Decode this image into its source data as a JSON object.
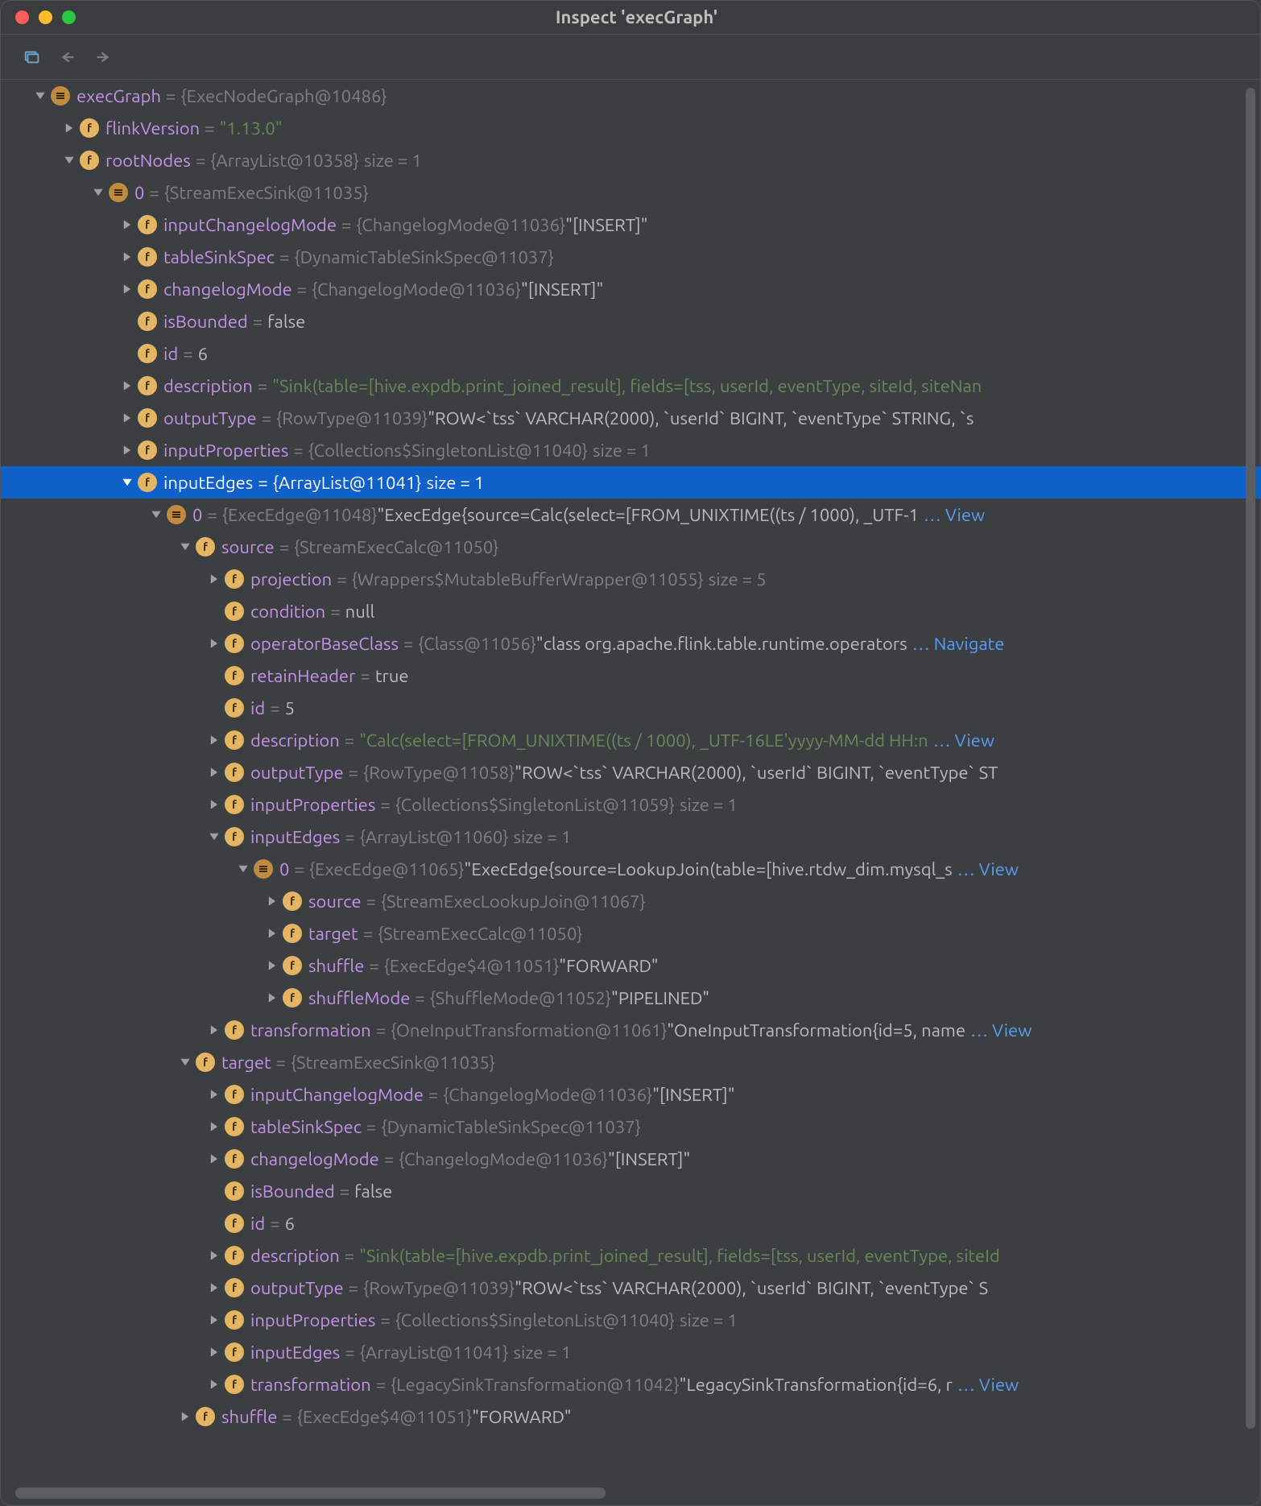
{
  "window_title": "Inspect 'execGraph'",
  "rows": [
    {
      "indent": 0,
      "chev": "down",
      "icon": "ar",
      "key": "execGraph",
      "eq": "=",
      "obj": "{ExecNodeGraph@10486}",
      "val": "",
      "link": ""
    },
    {
      "indent": 1,
      "chev": "right",
      "icon": "f",
      "key": "flinkVersion",
      "eq": "=",
      "obj": "",
      "val": "\"1.13.0\"",
      "valCls": "vstr",
      "link": ""
    },
    {
      "indent": 1,
      "chev": "down",
      "icon": "f",
      "key": "rootNodes",
      "eq": "=",
      "obj": "{ArrayList@10358}",
      "extra": "  size = 1",
      "link": ""
    },
    {
      "indent": 2,
      "chev": "down",
      "icon": "ar",
      "key": "0",
      "eq": "=",
      "obj": "{StreamExecSink@11035}",
      "link": ""
    },
    {
      "indent": 3,
      "chev": "right",
      "icon": "f",
      "key": "inputChangelogMode",
      "eq": "=",
      "obj": "{ChangelogMode@11036}",
      "val": " \"[INSERT]\"",
      "link": ""
    },
    {
      "indent": 3,
      "chev": "right",
      "icon": "f",
      "key": "tableSinkSpec",
      "eq": "=",
      "obj": "{DynamicTableSinkSpec@11037}",
      "link": ""
    },
    {
      "indent": 3,
      "chev": "right",
      "icon": "f",
      "key": "changelogMode",
      "eq": "=",
      "obj": "{ChangelogMode@11036}",
      "val": " \"[INSERT]\"",
      "link": ""
    },
    {
      "indent": 3,
      "chev": "none",
      "icon": "f",
      "key": "isBounded",
      "eq": "=",
      "obj": "",
      "val": "false",
      "link": ""
    },
    {
      "indent": 3,
      "chev": "none",
      "icon": "f",
      "key": "id",
      "eq": "=",
      "obj": "",
      "val": "6",
      "link": ""
    },
    {
      "indent": 3,
      "chev": "right",
      "icon": "f",
      "key": "description",
      "eq": "=",
      "obj": "",
      "val": "\"Sink(table=[hive.expdb.print_joined_result], fields=[tss, userId, eventType, siteId, siteNan",
      "valCls": "vstr",
      "link": ""
    },
    {
      "indent": 3,
      "chev": "right",
      "icon": "f",
      "key": "outputType",
      "eq": "=",
      "obj": "{RowType@11039}",
      "val": " \"ROW<`tss` VARCHAR(2000), `userId` BIGINT, `eventType` STRING, `s",
      "link": ""
    },
    {
      "indent": 3,
      "chev": "right",
      "icon": "f",
      "key": "inputProperties",
      "eq": "=",
      "obj": "{Collections$SingletonList@11040}",
      "extra": "  size = 1",
      "link": ""
    },
    {
      "indent": 3,
      "chev": "down",
      "icon": "f",
      "key": "inputEdges",
      "eq": "=",
      "obj": "{ArrayList@11041}",
      "extra": "  size = 1",
      "link": "",
      "sel": true
    },
    {
      "indent": 4,
      "chev": "down",
      "icon": "ar",
      "key": "0",
      "eq": "=",
      "obj": "{ExecEdge@11048}",
      "val": " \"ExecEdge{source=Calc(select=[FROM_UNIXTIME((ts / 1000), _UTF-1",
      "link": "… View"
    },
    {
      "indent": 5,
      "chev": "down",
      "icon": "f",
      "key": "source",
      "eq": "=",
      "obj": "{StreamExecCalc@11050}",
      "link": ""
    },
    {
      "indent": 6,
      "chev": "right",
      "icon": "f",
      "key": "projection",
      "eq": "=",
      "obj": "{Wrappers$MutableBufferWrapper@11055}",
      "extra": "  size = 5",
      "link": ""
    },
    {
      "indent": 6,
      "chev": "none",
      "icon": "f",
      "key": "condition",
      "eq": "=",
      "obj": "",
      "val": "null",
      "link": ""
    },
    {
      "indent": 6,
      "chev": "right",
      "icon": "f",
      "key": "operatorBaseClass",
      "eq": "=",
      "obj": "{Class@11056}",
      "val": " \"class org.apache.flink.table.runtime.operators",
      "link": "… Navigate"
    },
    {
      "indent": 6,
      "chev": "none",
      "icon": "f",
      "key": "retainHeader",
      "eq": "=",
      "obj": "",
      "val": "true",
      "link": ""
    },
    {
      "indent": 6,
      "chev": "none",
      "icon": "f",
      "key": "id",
      "eq": "=",
      "obj": "",
      "val": "5",
      "link": ""
    },
    {
      "indent": 6,
      "chev": "right",
      "icon": "f",
      "key": "description",
      "eq": "=",
      "obj": "",
      "val": "\"Calc(select=[FROM_UNIXTIME((ts / 1000), _UTF-16LE'yyyy-MM-dd HH:n",
      "valCls": "vstr",
      "link": "… View"
    },
    {
      "indent": 6,
      "chev": "right",
      "icon": "f",
      "key": "outputType",
      "eq": "=",
      "obj": "{RowType@11058}",
      "val": " \"ROW<`tss` VARCHAR(2000), `userId` BIGINT, `eventType` ST",
      "link": ""
    },
    {
      "indent": 6,
      "chev": "right",
      "icon": "f",
      "key": "inputProperties",
      "eq": "=",
      "obj": "{Collections$SingletonList@11059}",
      "extra": "  size = 1",
      "link": ""
    },
    {
      "indent": 6,
      "chev": "down",
      "icon": "f",
      "key": "inputEdges",
      "eq": "=",
      "obj": "{ArrayList@11060}",
      "extra": "  size = 1",
      "link": ""
    },
    {
      "indent": 7,
      "chev": "down",
      "icon": "ar",
      "key": "0",
      "eq": "=",
      "obj": "{ExecEdge@11065}",
      "val": " \"ExecEdge{source=LookupJoin(table=[hive.rtdw_dim.mysql_s",
      "link": "… View"
    },
    {
      "indent": 8,
      "chev": "right",
      "icon": "f",
      "key": "source",
      "eq": "=",
      "obj": "{StreamExecLookupJoin@11067}",
      "link": ""
    },
    {
      "indent": 8,
      "chev": "right",
      "icon": "f",
      "key": "target",
      "eq": "=",
      "obj": "{StreamExecCalc@11050}",
      "link": ""
    },
    {
      "indent": 8,
      "chev": "right",
      "icon": "f",
      "key": "shuffle",
      "eq": "=",
      "obj": "{ExecEdge$4@11051}",
      "val": " \"FORWARD\"",
      "link": ""
    },
    {
      "indent": 8,
      "chev": "right",
      "icon": "f",
      "key": "shuffleMode",
      "eq": "=",
      "obj": "{ShuffleMode@11052}",
      "val": " \"PIPELINED\"",
      "link": ""
    },
    {
      "indent": 6,
      "chev": "right",
      "icon": "f",
      "key": "transformation",
      "eq": "=",
      "obj": "{OneInputTransformation@11061}",
      "val": " \"OneInputTransformation{id=5, name",
      "link": "… View"
    },
    {
      "indent": 5,
      "chev": "down",
      "icon": "f",
      "key": "target",
      "eq": "=",
      "obj": "{StreamExecSink@11035}",
      "link": ""
    },
    {
      "indent": 6,
      "chev": "right",
      "icon": "f",
      "key": "inputChangelogMode",
      "eq": "=",
      "obj": "{ChangelogMode@11036}",
      "val": " \"[INSERT]\"",
      "link": ""
    },
    {
      "indent": 6,
      "chev": "right",
      "icon": "f",
      "key": "tableSinkSpec",
      "eq": "=",
      "obj": "{DynamicTableSinkSpec@11037}",
      "link": ""
    },
    {
      "indent": 6,
      "chev": "right",
      "icon": "f",
      "key": "changelogMode",
      "eq": "=",
      "obj": "{ChangelogMode@11036}",
      "val": " \"[INSERT]\"",
      "link": ""
    },
    {
      "indent": 6,
      "chev": "none",
      "icon": "f",
      "key": "isBounded",
      "eq": "=",
      "obj": "",
      "val": "false",
      "link": ""
    },
    {
      "indent": 6,
      "chev": "none",
      "icon": "f",
      "key": "id",
      "eq": "=",
      "obj": "",
      "val": "6",
      "link": ""
    },
    {
      "indent": 6,
      "chev": "right",
      "icon": "f",
      "key": "description",
      "eq": "=",
      "obj": "",
      "val": "\"Sink(table=[hive.expdb.print_joined_result], fields=[tss, userId, eventType, siteId",
      "valCls": "vstr",
      "link": ""
    },
    {
      "indent": 6,
      "chev": "right",
      "icon": "f",
      "key": "outputType",
      "eq": "=",
      "obj": "{RowType@11039}",
      "val": " \"ROW<`tss` VARCHAR(2000), `userId` BIGINT, `eventType` S",
      "link": ""
    },
    {
      "indent": 6,
      "chev": "right",
      "icon": "f",
      "key": "inputProperties",
      "eq": "=",
      "obj": "{Collections$SingletonList@11040}",
      "extra": "  size = 1",
      "link": ""
    },
    {
      "indent": 6,
      "chev": "right",
      "icon": "f",
      "key": "inputEdges",
      "eq": "=",
      "obj": "{ArrayList@11041}",
      "extra": "  size = 1",
      "link": ""
    },
    {
      "indent": 6,
      "chev": "right",
      "icon": "f",
      "key": "transformation",
      "eq": "=",
      "obj": "{LegacySinkTransformation@11042}",
      "val": " \"LegacySinkTransformation{id=6, r",
      "link": "… View"
    },
    {
      "indent": 5,
      "chev": "right",
      "icon": "f",
      "key": "shuffle",
      "eq": "=",
      "obj": "{ExecEdge$4@11051}",
      "val": " \"FORWARD\"",
      "link": ""
    }
  ]
}
